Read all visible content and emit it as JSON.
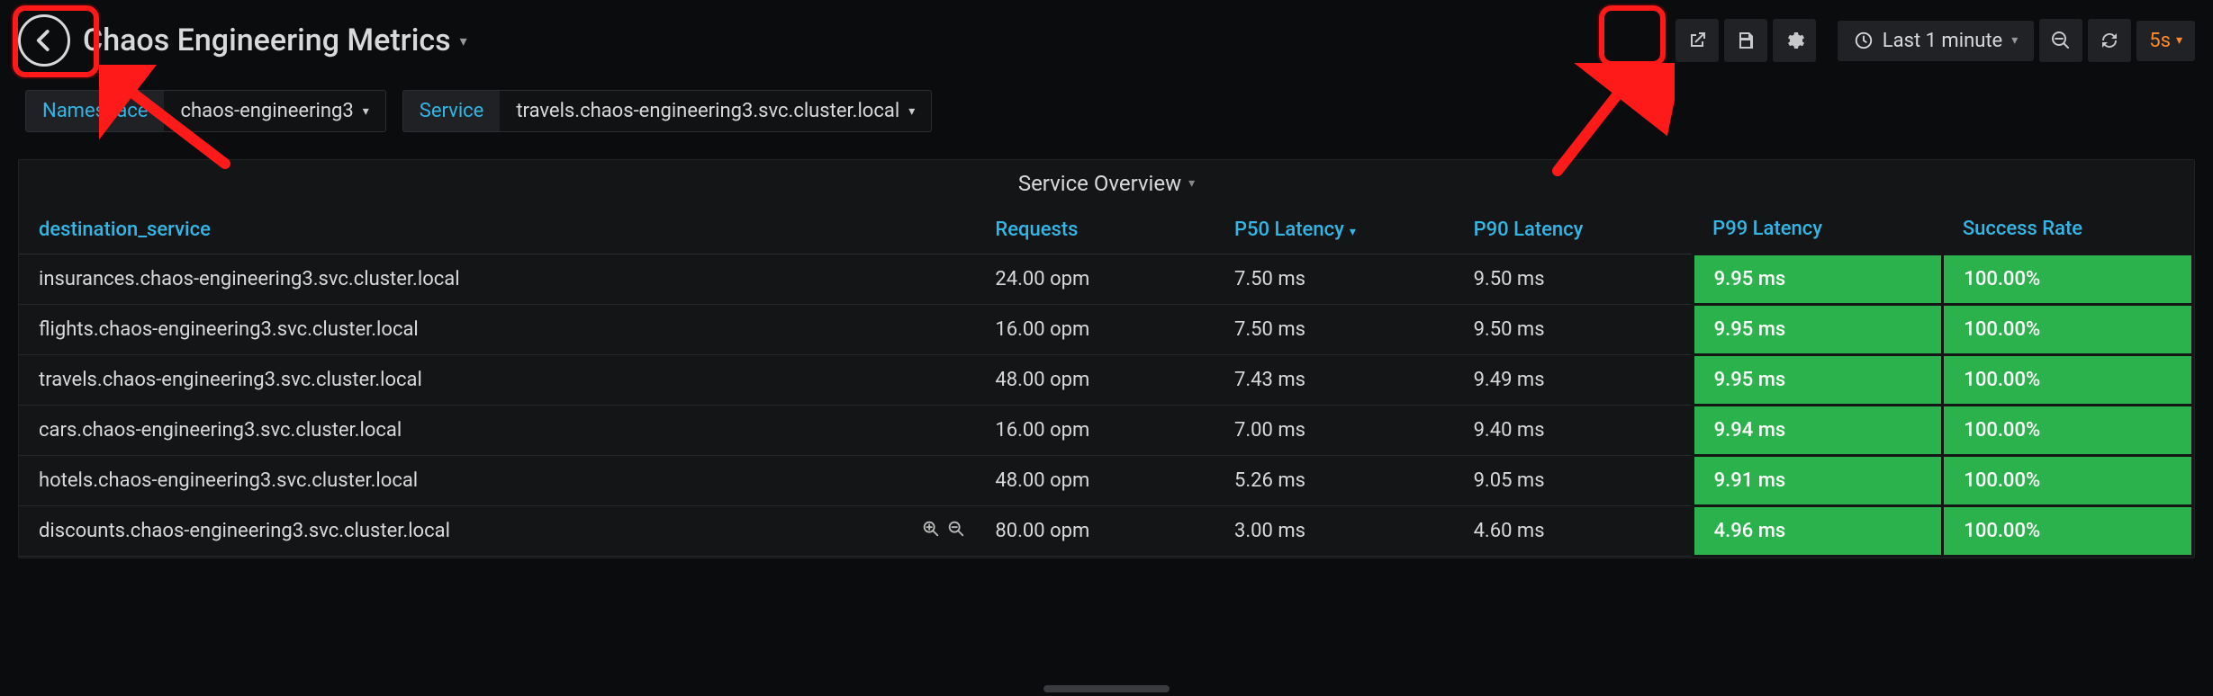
{
  "header": {
    "title": "Chaos Engineering Metrics",
    "time_label": "Last 1 minute",
    "refresh_interval": "5s"
  },
  "variables": {
    "namespace": {
      "label": "Namespace",
      "value": "chaos-engineering3"
    },
    "service": {
      "label": "Service",
      "value": "travels.chaos-engineering3.svc.cluster.local"
    }
  },
  "panel": {
    "title": "Service Overview",
    "columns": {
      "dest": "destination_service",
      "req": "Requests",
      "p50": "P50 Latency",
      "p90": "P90 Latency",
      "p99": "P99 Latency",
      "succ": "Success Rate"
    },
    "rows": [
      {
        "dest": "insurances.chaos-engineering3.svc.cluster.local",
        "req": "24.00 opm",
        "p50": "7.50 ms",
        "p90": "9.50 ms",
        "p99": "9.95 ms",
        "succ": "100.00%"
      },
      {
        "dest": "flights.chaos-engineering3.svc.cluster.local",
        "req": "16.00 opm",
        "p50": "7.50 ms",
        "p90": "9.50 ms",
        "p99": "9.95 ms",
        "succ": "100.00%"
      },
      {
        "dest": "travels.chaos-engineering3.svc.cluster.local",
        "req": "48.00 opm",
        "p50": "7.43 ms",
        "p90": "9.49 ms",
        "p99": "9.95 ms",
        "succ": "100.00%"
      },
      {
        "dest": "cars.chaos-engineering3.svc.cluster.local",
        "req": "16.00 opm",
        "p50": "7.00 ms",
        "p90": "9.40 ms",
        "p99": "9.94 ms",
        "succ": "100.00%"
      },
      {
        "dest": "hotels.chaos-engineering3.svc.cluster.local",
        "req": "48.00 opm",
        "p50": "5.26 ms",
        "p90": "9.05 ms",
        "p99": "9.91 ms",
        "succ": "100.00%"
      },
      {
        "dest": "discounts.chaos-engineering3.svc.cluster.local",
        "req": "80.00 opm",
        "p50": "3.00 ms",
        "p90": "4.60 ms",
        "p99": "4.96 ms",
        "succ": "100.00%"
      }
    ]
  }
}
